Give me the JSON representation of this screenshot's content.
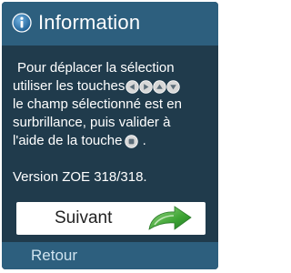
{
  "dialog": {
    "title": "Information",
    "title_icon": "info-icon",
    "message": {
      "line1": "Pour déplacer la sélection",
      "line2_text": "utiliser les touches",
      "line2_icons": [
        "left-arrow-key-icon",
        "right-arrow-key-icon",
        "up-arrow-key-icon",
        "down-arrow-key-icon"
      ],
      "line3": "le champ sélectionné est en",
      "line4": "surbrillance, puis valider à",
      "line5_text": "l'aide de la touche",
      "line5_icon": "ok-key-icon",
      "line5_end": "."
    },
    "version": "Version ZOE 318/318.",
    "next_button": {
      "label": "Suivant",
      "icon": "next-arrow-icon"
    },
    "back_label": "Retour"
  },
  "colors": {
    "background": "#203b4c",
    "header": "#2d5f7e",
    "text": "#ffffff",
    "button_bg": "#ffffff",
    "arrow_green": "#4caf50",
    "back_text": "#cfe3ef"
  }
}
